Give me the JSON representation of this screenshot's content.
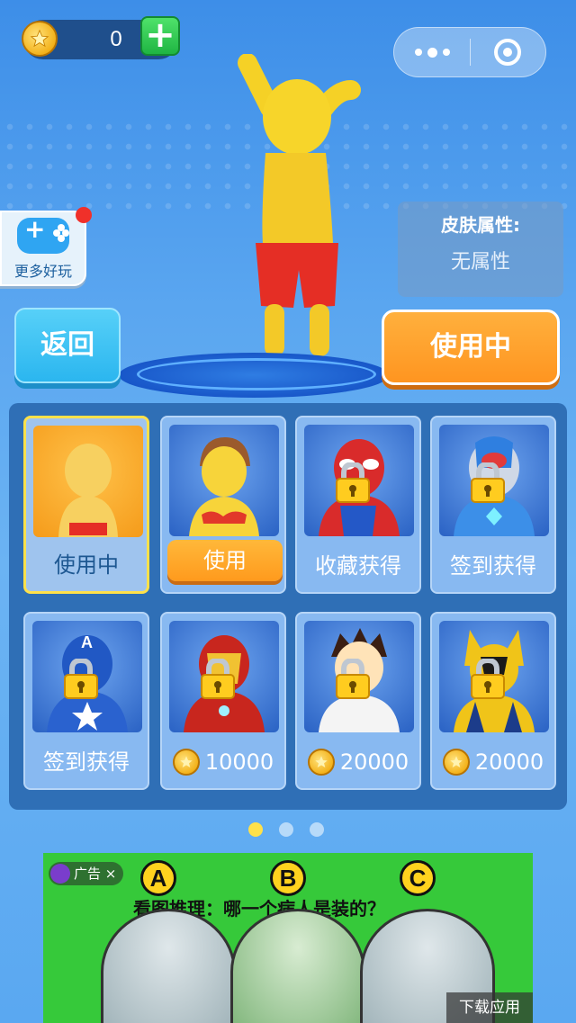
{
  "header": {
    "coin_count": "0",
    "plus_label": "+"
  },
  "more_fun": {
    "label": "更多好玩"
  },
  "skin_panel": {
    "title": "皮肤属性:",
    "value": "无属性"
  },
  "buttons": {
    "back": "返回",
    "using": "使用中"
  },
  "skins": [
    {
      "label": "使用中",
      "state": "selected"
    },
    {
      "label": "使用",
      "state": "use"
    },
    {
      "label": "收藏获得",
      "state": "locked"
    },
    {
      "label": "签到获得",
      "state": "locked"
    },
    {
      "label": "签到获得",
      "state": "locked"
    },
    {
      "label": "10000",
      "state": "price"
    },
    {
      "label": "20000",
      "state": "price"
    },
    {
      "label": "20000",
      "state": "price"
    }
  ],
  "pagination": {
    "pages": 3,
    "active": 1
  },
  "ad": {
    "tag": "广告 ×",
    "options": [
      "A",
      "B",
      "C"
    ],
    "title": "看图推理：哪一个病人是装的？",
    "download": "下载应用"
  },
  "colors": {
    "accent_orange": "#ff9a1d",
    "selected_border": "#ffe14a",
    "panel_blue": "#2f6fb6"
  }
}
